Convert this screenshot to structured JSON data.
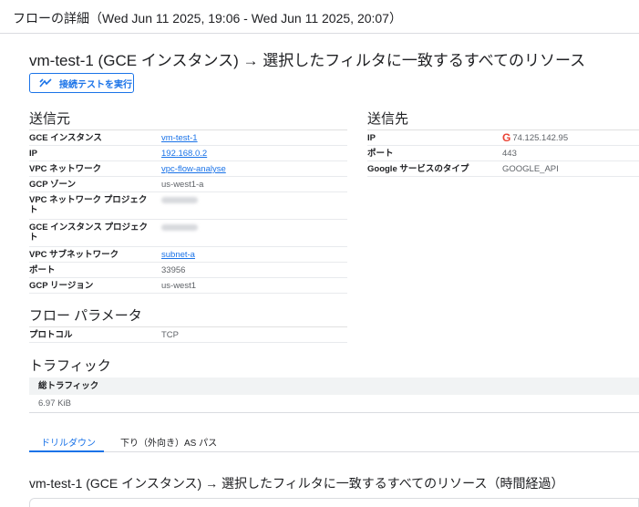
{
  "header": {
    "title": "フローの詳細（Wed Jun 11 2025, 19:06 - Wed Jun 11 2025, 20:07）"
  },
  "main": {
    "title": "vm-test-1 (GCE インスタンス) → 選択したフィルタに一致するすべてのリソース",
    "connectivity_button": "接続テストを実行"
  },
  "source": {
    "title": "送信元",
    "rows": [
      {
        "key": "GCE インスタンス",
        "value": "vm-test-1",
        "link": true
      },
      {
        "key": "IP",
        "value": "192.168.0.2",
        "link": true
      },
      {
        "key": "VPC ネットワーク",
        "value": "vpc-flow-analyse",
        "link": true
      },
      {
        "key": "GCP ゾーン",
        "value": "us-west1-a",
        "link": false
      },
      {
        "key": "VPC ネットワーク プロジェクト",
        "value": "",
        "link": false,
        "redacted": true
      },
      {
        "key": "GCE インスタンス プロジェクト",
        "value": "",
        "link": false,
        "redacted": true
      },
      {
        "key": "VPC サブネットワーク",
        "value": "subnet-a",
        "link": true
      },
      {
        "key": "ポート",
        "value": "33956",
        "link": false
      },
      {
        "key": "GCP リージョン",
        "value": "us-west1",
        "link": false
      }
    ]
  },
  "destination": {
    "title": "送信先",
    "rows": [
      {
        "key": "IP",
        "value": "74.125.142.95",
        "link": false,
        "icon": "google-g-icon"
      },
      {
        "key": "ポート",
        "value": "443",
        "link": false
      },
      {
        "key": "Google サービスのタイプ",
        "value": "GOOGLE_API",
        "link": false
      }
    ]
  },
  "flow_params": {
    "title": "フロー パラメータ",
    "rows": [
      {
        "key": "プロトコル",
        "value": "TCP",
        "link": false
      }
    ]
  },
  "traffic": {
    "title": "トラフィック",
    "header": "総トラフィック",
    "value": "6.97 KiB"
  },
  "tabs": [
    {
      "label": "ドリルダウン",
      "active": true
    },
    {
      "label": "下り（外向き）AS パス",
      "active": false
    }
  ],
  "bottom": {
    "title": "vm-test-1 (GCE インスタンス) → 選択したフィルタに一致するすべてのリソース（時間経過）"
  },
  "colors": {
    "accent": "#1a73e8",
    "google_red": "#ea4335",
    "muted": "#5f6368"
  }
}
